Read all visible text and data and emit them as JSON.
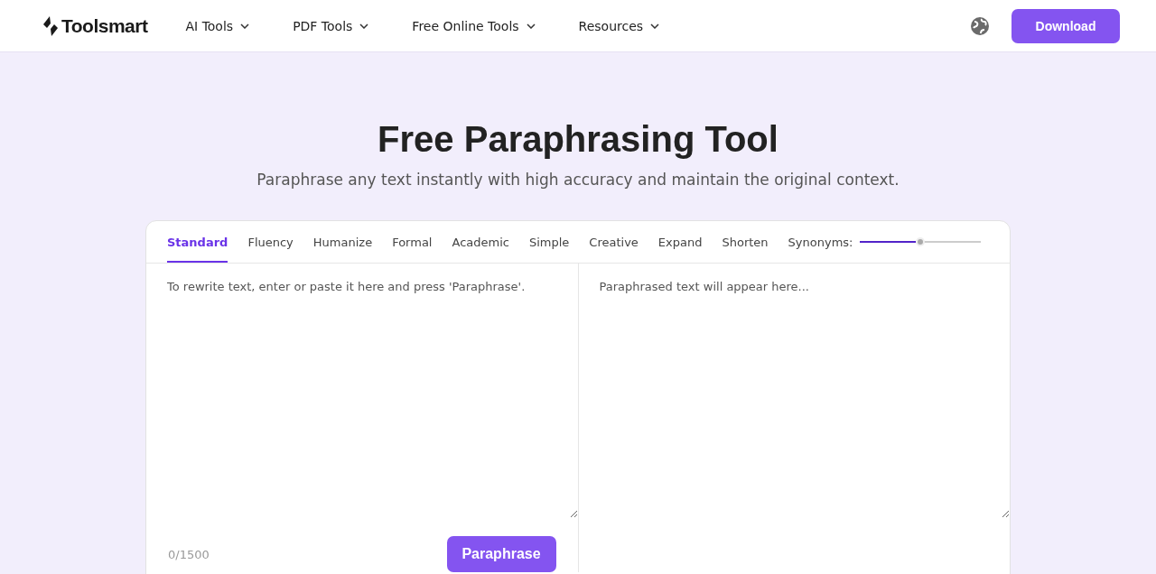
{
  "header": {
    "logo": "Toolsmart",
    "nav": [
      {
        "label": "AI Tools"
      },
      {
        "label": "PDF Tools"
      },
      {
        "label": "Free Online Tools"
      },
      {
        "label": "Resources"
      }
    ],
    "download": "Download"
  },
  "hero": {
    "title": "Free Paraphrasing Tool",
    "subtitle": "Paraphrase any text instantly with high accuracy and maintain the original context."
  },
  "tool": {
    "modes": [
      {
        "label": "Standard",
        "selected": true
      },
      {
        "label": "Fluency",
        "selected": false
      },
      {
        "label": "Humanize",
        "selected": false
      },
      {
        "label": "Formal",
        "selected": false
      },
      {
        "label": "Academic",
        "selected": false
      },
      {
        "label": "Simple",
        "selected": false
      },
      {
        "label": "Creative",
        "selected": false
      },
      {
        "label": "Expand",
        "selected": false
      },
      {
        "label": "Shorten",
        "selected": false
      }
    ],
    "synonyms": {
      "label": "Synonyms:",
      "level": 0.5
    },
    "input": {
      "placeholder": "To rewrite text, enter or paste it here and press 'Paraphrase'."
    },
    "output": {
      "placeholder": "Paraphrased text will appear here..."
    },
    "counter": "0/1500",
    "submit": "Paraphrase"
  }
}
